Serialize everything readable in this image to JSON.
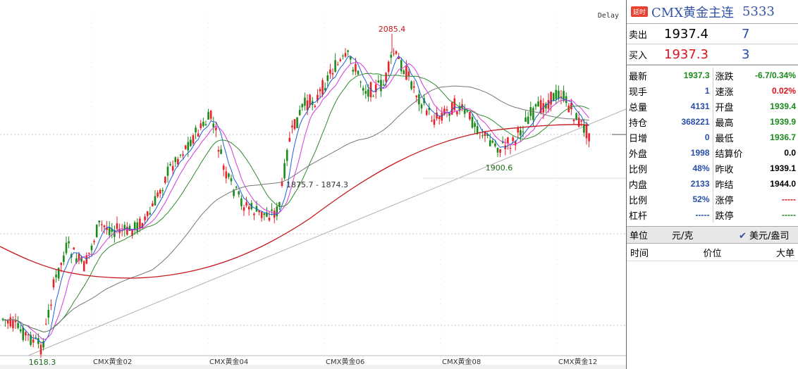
{
  "chart": {
    "delay_label": "Delay",
    "price_labels": {
      "high": "2085.4",
      "low": "1618.3",
      "mid_low": "1900.6",
      "range": "1875.7 - 1874.3"
    },
    "x_labels": [
      "CMX黄金02",
      "CMX黄金04",
      "CMX黄金06",
      "CMX黄金08",
      "CMX黄金12"
    ],
    "colors": {
      "up": "#e8222a",
      "down": "#1a8a1a",
      "ma5": "#1e5fd8",
      "ma10": "#d63ad6",
      "ma20": "#2e8b2e",
      "ma60": "#777777",
      "ma120": "#c4161c",
      "trend": "#b0b0b0"
    }
  },
  "panel": {
    "tag": "延时",
    "title": "CMX黄金主连",
    "code": "5333",
    "sell": {
      "label": "卖出",
      "price": "1937.4",
      "vol": "7"
    },
    "buy": {
      "label": "买入",
      "price": "1937.3",
      "vol": "3"
    },
    "left": [
      {
        "k": "最新",
        "v": "1937.3",
        "c": "green"
      },
      {
        "k": "现手",
        "v": "1",
        "c": "blue"
      },
      {
        "k": "总量",
        "v": "4131",
        "c": "blue"
      },
      {
        "k": "持仓",
        "v": "368221",
        "c": "blue"
      },
      {
        "k": "日增",
        "v": "0",
        "c": "blue"
      },
      {
        "k": "外盘",
        "v": "1998",
        "c": "blue"
      },
      {
        "k": "比例",
        "v": "48%",
        "c": "blue"
      },
      {
        "k": "内盘",
        "v": "2133",
        "c": "blue"
      },
      {
        "k": "比例",
        "v": "52%",
        "c": "blue"
      },
      {
        "k": "杠杆",
        "v": "-----",
        "c": "blue"
      }
    ],
    "right": [
      {
        "k": "涨跌",
        "v": "-6.7/0.34%",
        "c": "green"
      },
      {
        "k": "速涨",
        "v": "0.02%",
        "c": "red"
      },
      {
        "k": "开盘",
        "v": "1939.4",
        "c": "green"
      },
      {
        "k": "最高",
        "v": "1939.9",
        "c": "green"
      },
      {
        "k": "最低",
        "v": "1936.7",
        "c": "green"
      },
      {
        "k": "结算价",
        "v": "0.0",
        "c": ""
      },
      {
        "k": "昨收",
        "v": "1939.1",
        "c": ""
      },
      {
        "k": "昨结",
        "v": "1944.0",
        "c": ""
      },
      {
        "k": "涨停",
        "v": "-----",
        "c": "red"
      },
      {
        "k": "跌停",
        "v": "-----",
        "c": "green"
      }
    ],
    "unit_label": "单位",
    "unit_a": "元/克",
    "unit_b": "美元/盎司",
    "cols": {
      "time": "时间",
      "price": "价位",
      "big": "大单"
    }
  }
}
